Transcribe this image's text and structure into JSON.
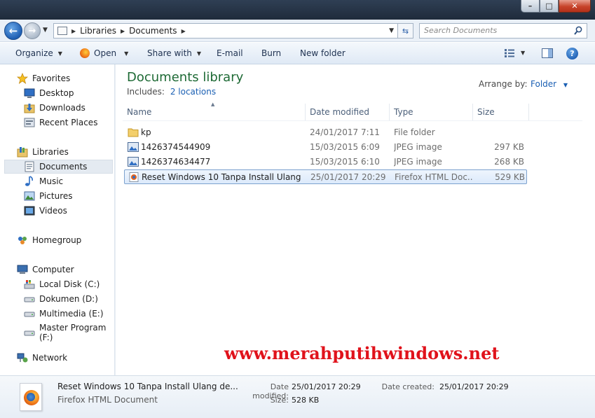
{
  "window": {
    "minimize": "–",
    "maximize": "□",
    "close": "✕"
  },
  "address": {
    "back": "←",
    "forward": "→",
    "crumbs": [
      "Libraries",
      "Documents"
    ],
    "search_placeholder": "Search Documents"
  },
  "toolbar": {
    "organize": "Organize",
    "open": "Open",
    "share_with": "Share with",
    "email": "E-mail",
    "burn": "Burn",
    "new_folder": "New folder",
    "help": "?"
  },
  "nav": {
    "favorites": "Favorites",
    "desktop": "Desktop",
    "downloads": "Downloads",
    "recent_places": "Recent Places",
    "libraries": "Libraries",
    "documents": "Documents",
    "music": "Music",
    "pictures": "Pictures",
    "videos": "Videos",
    "homegroup": "Homegroup",
    "computer": "Computer",
    "local_disk": "Local Disk (C:)",
    "dokumen": "Dokumen (D:)",
    "multimedia": "Multimedia (E:)",
    "master_program": "Master Program (F:)",
    "network": "Network"
  },
  "library": {
    "title": "Documents library",
    "includes_label": "Includes:",
    "includes_link": "2 locations",
    "arrange_label": "Arrange by:",
    "arrange_value": "Folder"
  },
  "columns": {
    "name": "Name",
    "date": "Date modified",
    "type": "Type",
    "size": "Size"
  },
  "files": [
    {
      "name": "kp",
      "date": "24/01/2017 7:11",
      "type": "File folder",
      "size": "",
      "icon": "folder-icon"
    },
    {
      "name": "1426374544909",
      "date": "15/03/2015 6:09",
      "type": "JPEG image",
      "size": "297 KB",
      "icon": "image-icon"
    },
    {
      "name": "1426374634477",
      "date": "15/03/2015 6:10",
      "type": "JPEG image",
      "size": "268 KB",
      "icon": "image-icon"
    },
    {
      "name": "Reset Windows 10 Tanpa Install Ulang de...",
      "date": "25/01/2017 20:29",
      "type": "Firefox HTML Doc...",
      "size": "529 KB",
      "icon": "firefox-html-icon"
    }
  ],
  "watermark": "www.merahputihwindows.net",
  "details": {
    "name": "Reset Windows 10 Tanpa Install Ulang de...",
    "type": "Firefox HTML Document",
    "modified_label": "Date modified:",
    "modified_value": "25/01/2017 20:29",
    "size_label": "Size:",
    "size_value": "528 KB",
    "created_label": "Date created:",
    "created_value": "25/01/2017 20:29"
  }
}
